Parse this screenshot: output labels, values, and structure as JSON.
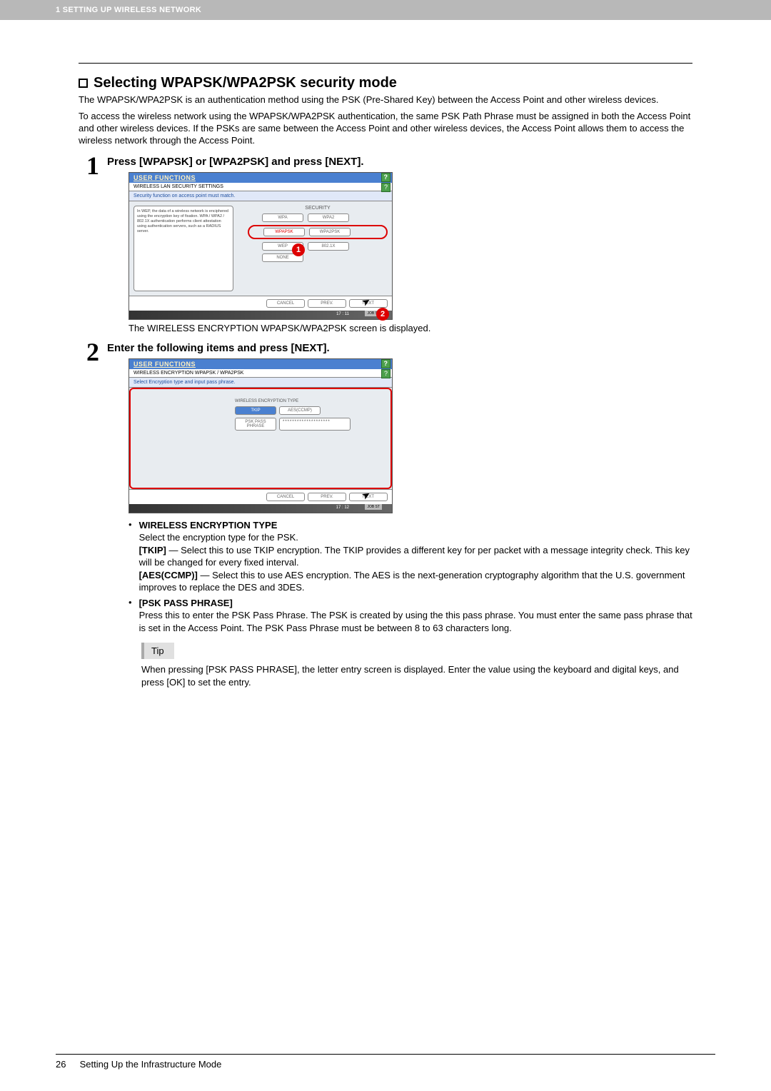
{
  "header": {
    "chapter": "1 SETTING UP WIRELESS NETWORK"
  },
  "section_heading": "Selecting WPAPSK/WPA2PSK security mode",
  "intro1": "The WPAPSK/WPA2PSK is an authentication method using the PSK (Pre-Shared Key) between the Access Point and other wireless devices.",
  "intro2": "To access the wireless network using the WPAPSK/WPA2PSK authentication, the same PSK Path Phrase must be assigned in both the Access Point and other wireless devices. If the PSKs are same between the Access Point and other wireless devices, the Access Point allows them to access the wireless network through the Access Point.",
  "step1": {
    "num": "1",
    "title": "Press [WPAPSK] or [WPA2PSK] and press [NEXT].",
    "after": "The WIRELESS ENCRYPTION WPAPSK/WPA2PSK screen is displayed."
  },
  "step2": {
    "num": "2",
    "title": "Enter the following items and press [NEXT]."
  },
  "ss1": {
    "titlebar": "USER FUNCTIONS",
    "subheader": "WIRELESS LAN SECURITY SETTINGS",
    "instr": "Security function on access point must match.",
    "info": "In WEP, the data of a wireless network is enciphered using the encryption key of fixation. WPA / WPA2 / 802.1X authentication performs client attestation using authentication servers, such as a RADIUS server.",
    "security_label": "SECURITY",
    "btn_wpa": "WPA",
    "btn_wpa2": "WPA2",
    "btn_wpapsk": "WPAPSK",
    "btn_wpa2psk": "WPA2PSK",
    "btn_wep": "WEP",
    "btn_8021x": "802.1X",
    "btn_none": "NONE",
    "cancel": "CANCEL",
    "prev": "PREV.",
    "next": "NEXT",
    "time": "17 : 11",
    "jobst": "JOB ST"
  },
  "ss2": {
    "titlebar": "USER FUNCTIONS",
    "subheader": "WIRELESS ENCRYPTION WPAPSK / WPA2PSK",
    "instr": "Select Encryption type and input pass phrase.",
    "enc_label": "WIRELESS ENCRYPTION TYPE",
    "btn_tkip": "TKIP",
    "btn_aes": "AES(CCMP)",
    "btn_psk": "PSK PASS PHRASE",
    "input_val": "********************",
    "cancel": "CANCEL",
    "prev": "PREV.",
    "next": "NEXT",
    "time": "17 : 12",
    "jobst": "JOB ST"
  },
  "bullets": {
    "enc_heading": "WIRELESS ENCRYPTION TYPE",
    "enc_intro": "Select the encryption type for the PSK.",
    "tkip_bold": "[TKIP]",
    "tkip_text": " — Select this to use TKIP encryption.  The TKIP provides a different key for per packet with a message integrity check.  This key will be changed for every fixed interval.",
    "aes_bold": "[AES(CCMP)]",
    "aes_text": " — Select this to use AES encryption.  The AES is the next-generation cryptography algorithm that the U.S. government improves to replace the DES and 3DES.",
    "psk_heading": "[PSK PASS PHRASE]",
    "psk_text": "Press this to enter the PSK Pass Phrase.  The PSK is created by using the this pass phrase.  You must enter the same pass phrase that is set in the Access Point.  The PSK Pass Phrase must be between 8 to 63 characters long."
  },
  "tip": {
    "label": "Tip",
    "text": "When pressing [PSK PASS PHRASE], the letter entry screen is displayed. Enter the value using the keyboard and digital keys, and press [OK] to set the entry."
  },
  "footer": {
    "page": "26",
    "section": "Setting Up the Infrastructure Mode"
  }
}
